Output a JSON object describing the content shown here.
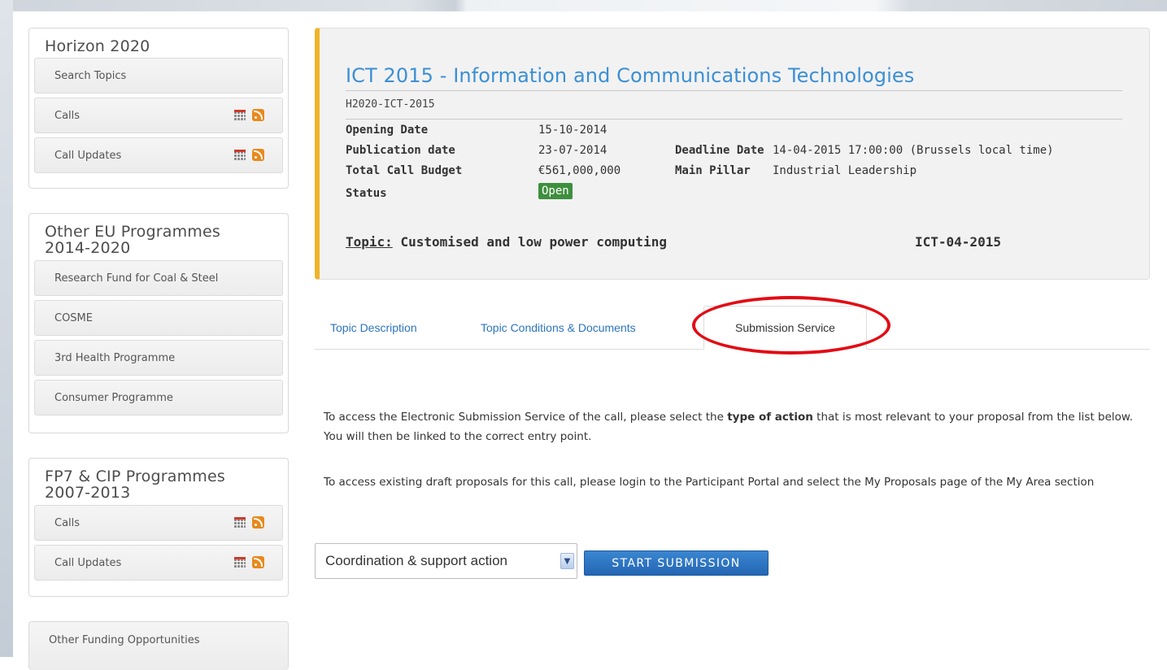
{
  "sidebar": {
    "horizon": {
      "title": "Horizon 2020",
      "items": [
        "Search Topics",
        "Calls",
        "Call Updates"
      ]
    },
    "other_eu": {
      "title_line1": "Other EU Programmes",
      "title_line2": "2014-2020",
      "items": [
        "Research Fund for Coal & Steel",
        "COSME",
        "3rd Health Programme",
        "Consumer Programme"
      ]
    },
    "fp7": {
      "title_line1": "FP7 & CIP Programmes",
      "title_line2": "2007-2013",
      "items": [
        "Calls",
        "Call Updates"
      ]
    },
    "other_funding": "Other Funding Opportunities"
  },
  "call": {
    "title": "ICT 2015 - Information and Communications Technologies",
    "identifier": "H2020-ICT-2015",
    "opening_date_label": "Opening Date",
    "opening_date": "15-10-2014",
    "publication_date_label": "Publication date",
    "publication_date": "23-07-2014",
    "deadline_label": "Deadline Date",
    "deadline": "14-04-2015 17:00:00 (Brussels local time)",
    "budget_label": "Total Call Budget",
    "budget": "€561,000,000",
    "pillar_label": "Main Pillar",
    "pillar": "Industrial Leadership",
    "status_label": "Status",
    "status": "Open",
    "topic_label": "Topic:",
    "topic": "Customised and low power computing",
    "topic_code": "ICT-04-2015"
  },
  "tabs": [
    "Topic Description",
    "Topic Conditions & Documents",
    "Submission Service"
  ],
  "content": {
    "para1_pre": "To access the Electronic Submission Service of the call, please select the ",
    "para1_bold": "type of action",
    "para1_post": " that is most relevant to your proposal from the list below. You will then be linked to the correct entry point.",
    "para2": "To access existing draft proposals for this call, please login to the Participant Portal and select the My Proposals page of the My Area section"
  },
  "form": {
    "action_type_selected": "Coordination & support action",
    "start_button": "START SUBMISSION"
  },
  "colors": {
    "accent_blue": "#3b8fd4",
    "status_green": "#3e8f3e",
    "highlight_red": "#e30b14",
    "info_border": "#f0b428"
  }
}
